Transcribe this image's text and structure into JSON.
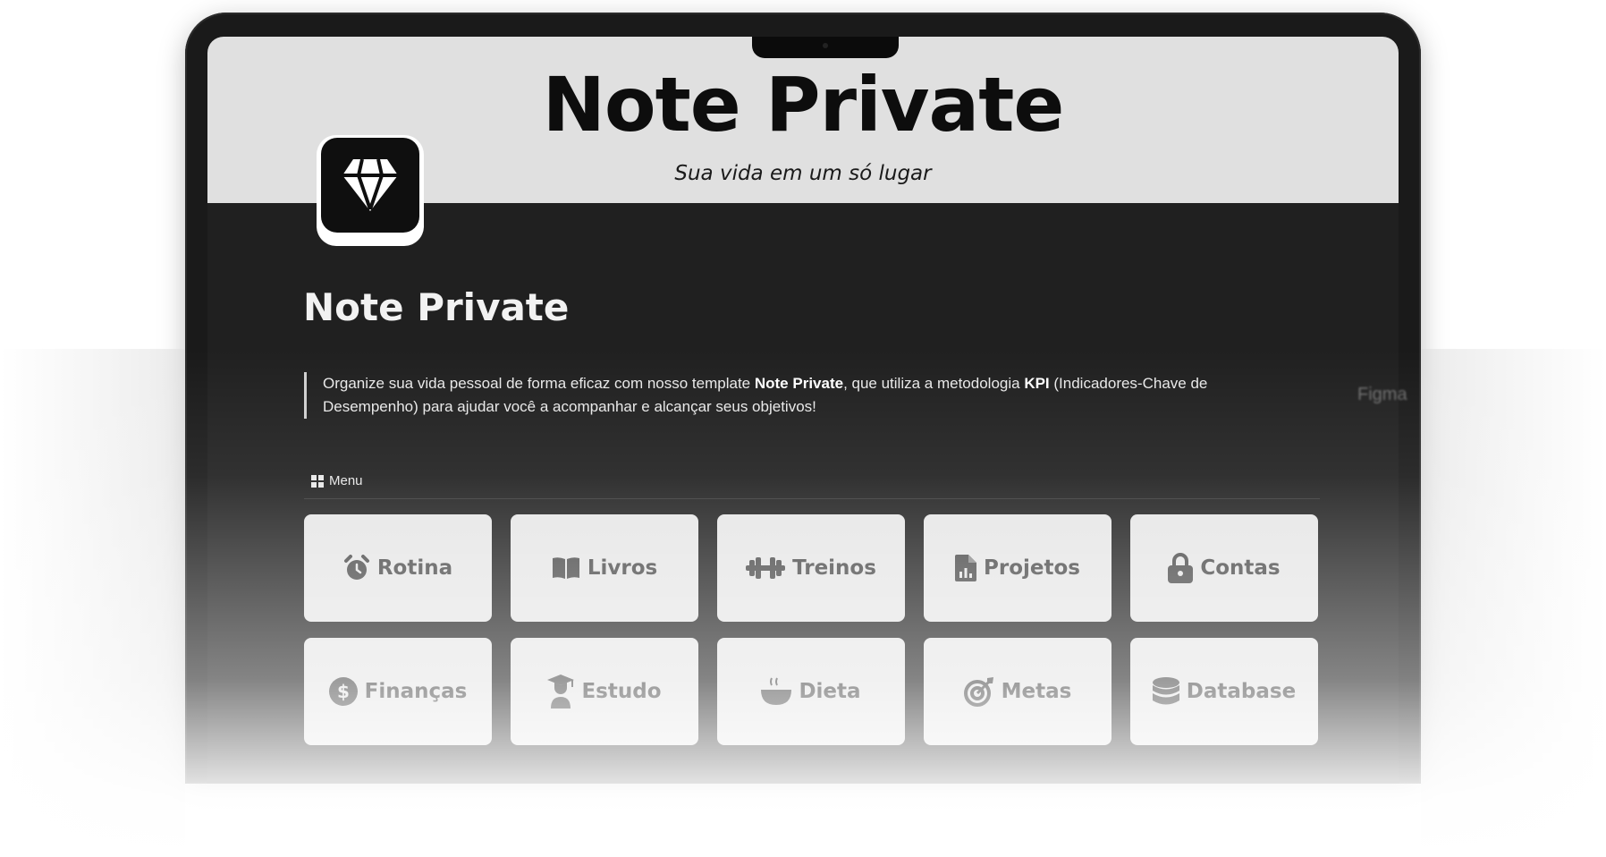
{
  "cover": {
    "title": "Note Private",
    "subtitle": "Sua vida em um só lugar"
  },
  "page": {
    "icon": "diamond-icon",
    "title": "Note Private",
    "description": {
      "part1": "Organize sua vida pessoal de forma eficaz com nosso template ",
      "bold1": "Note Private",
      "part2": ", que utiliza a metodologia ",
      "bold2": "KPI",
      "part3": " (Indicadores-Chave de Desempenho) para ajudar você a acompanhar e alcançar seus objetivos!"
    }
  },
  "menu": {
    "label": "Menu",
    "icon": "grid-icon",
    "items": [
      {
        "label": "Rotina",
        "icon": "alarm-clock-icon"
      },
      {
        "label": "Livros",
        "icon": "book-icon"
      },
      {
        "label": "Treinos",
        "icon": "dumbbell-icon"
      },
      {
        "label": "Projetos",
        "icon": "file-chart-icon"
      },
      {
        "label": "Contas",
        "icon": "lock-icon"
      },
      {
        "label": "Finanças",
        "icon": "dollar-circle-icon"
      },
      {
        "label": "Estudo",
        "icon": "graduate-icon"
      },
      {
        "label": "Dieta",
        "icon": "bowl-icon"
      },
      {
        "label": "Metas",
        "icon": "target-icon"
      },
      {
        "label": "Database",
        "icon": "database-icon"
      }
    ]
  },
  "side_text": "Figma",
  "colors": {
    "cover_bg": "#e0e0e0",
    "page_bg": "#202020",
    "card_bg": "#e6e6e6",
    "card_text": "#4a4a4a"
  }
}
